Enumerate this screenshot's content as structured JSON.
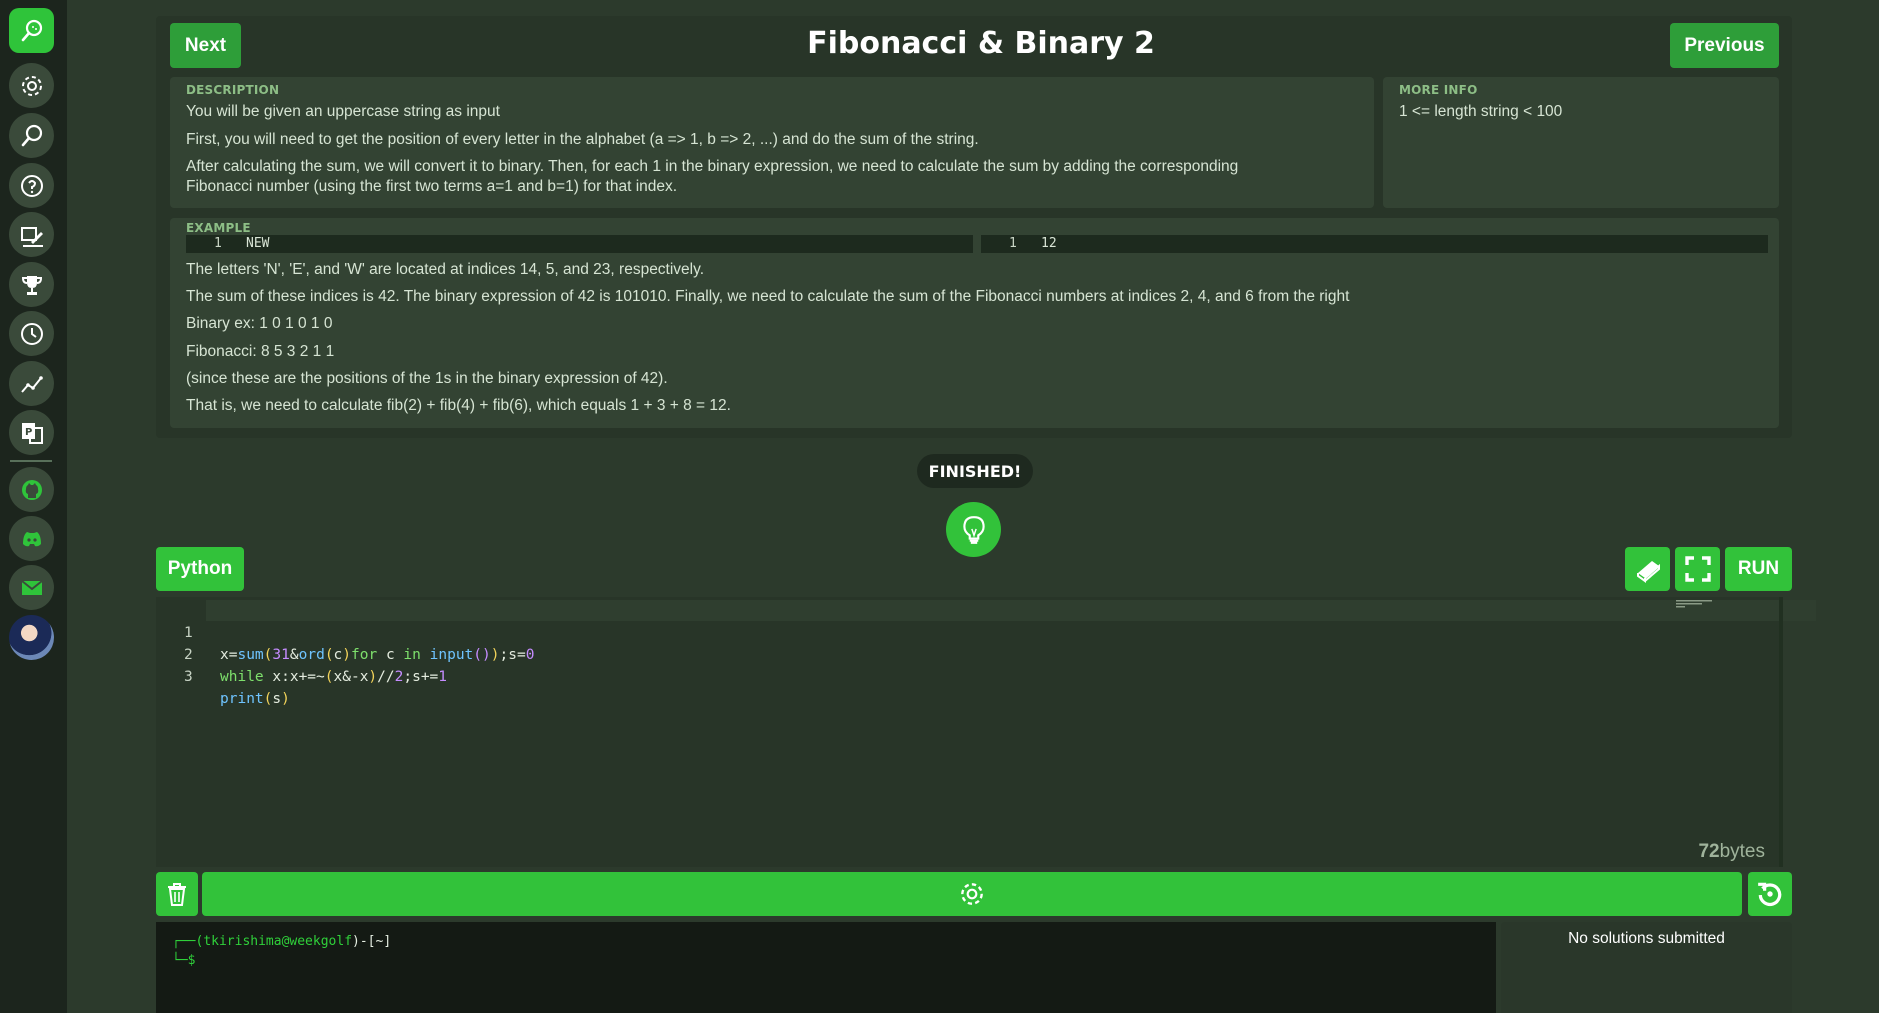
{
  "sidebar": {
    "items": [
      {
        "icon": "golf-club-icon",
        "active": true
      },
      {
        "icon": "gear-icon"
      },
      {
        "icon": "golf-club-icon"
      },
      {
        "icon": "help-icon"
      },
      {
        "icon": "code-edit-icon"
      },
      {
        "icon": "trophy-icon"
      },
      {
        "icon": "clock-icon"
      },
      {
        "icon": "trend-chart-icon"
      },
      {
        "icon": "translate-icon"
      }
    ],
    "social": [
      {
        "icon": "github-icon"
      },
      {
        "icon": "discord-icon"
      },
      {
        "icon": "mail-icon"
      },
      {
        "icon": "avatar"
      }
    ]
  },
  "header": {
    "next_label": "Next",
    "previous_label": "Previous",
    "title": "Fibonacci & Binary 2"
  },
  "description": {
    "label": "DESCRIPTION",
    "lines": [
      "You will be given an uppercase string as input",
      "First, you will need to get the position of every letter in the alphabet (a => 1, b => 2, ...) and do the sum of the string.",
      "After calculating the sum, we will convert it to binary. Then, for each 1 in the binary expression, we need to calculate the sum by adding the corresponding Fibonacci number (using the first two terms a=1 and b=1) for that index."
    ]
  },
  "more_info": {
    "label": "MORE INFO",
    "text": "1 <= length string < 100"
  },
  "example": {
    "label": "EXAMPLE",
    "input": {
      "line_number": "1",
      "value": "NEW"
    },
    "output": {
      "line_number": "1",
      "value": "12"
    },
    "lines": [
      "The letters 'N', 'E', and 'W' are located at indices 14, 5, and 23, respectively.",
      "The sum of these indices is 42. The binary expression of 42 is 101010. Finally, we need to calculate the sum of the Fibonacci numbers at indices 2, 4, and 6 from the right",
      "Binary ex: 1 0 1 0 1 0",
      "Fibonacci: 8 5 3 2 1 1",
      "(since these are the positions of the 1s in the binary expression of 42).",
      "That is, we need to calculate fib(2) + fib(4) + fib(6), which equals 1 + 3 + 8 = 12."
    ]
  },
  "status": {
    "finished_label": "FINISHED!",
    "hint_icon": "lightbulb-icon"
  },
  "editor": {
    "language": "Python",
    "run_label": "RUN",
    "line_numbers": [
      "1",
      "2",
      "3"
    ],
    "code": [
      "x=sum(31&ord(c)for c in input());s=0",
      "while x:x+=~(x&-x)//2;s+=1",
      "print(s)"
    ],
    "byte_count": "72",
    "byte_unit": "bytes"
  },
  "terminal": {
    "prompt_prefix": "┌──(",
    "user": "tkirishima@weekgolf",
    "prompt_mid": ")-[",
    "dir": "~",
    "prompt_end": "]",
    "second_line": "└─$"
  },
  "solutions": {
    "text": "No solutions submitted"
  },
  "colors": {
    "accent": "#32c23a",
    "dark_button": "#2e9e39",
    "background": "#2c3a2c",
    "sidebar": "#1c251d"
  }
}
